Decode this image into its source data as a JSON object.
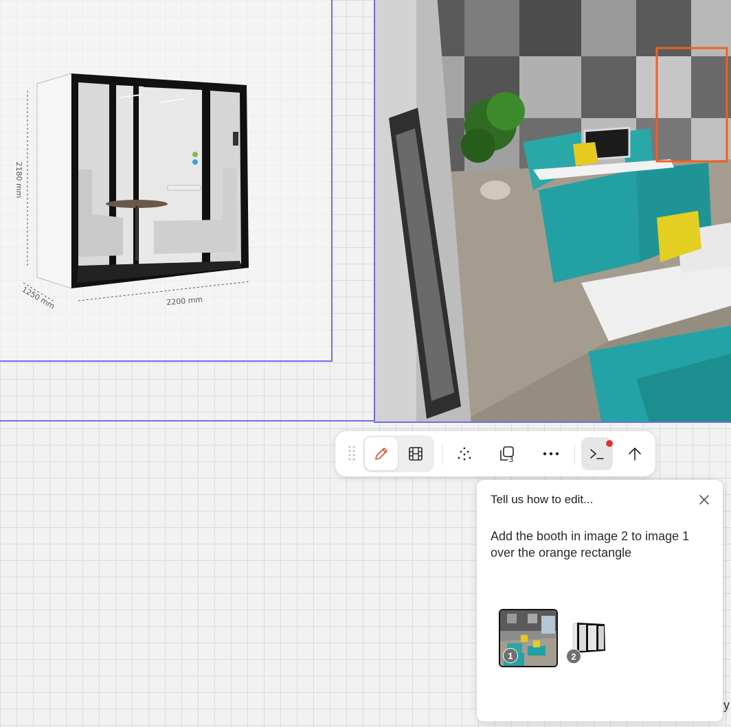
{
  "canvas": {
    "grid_color": "#dcdcdc",
    "selection_color": "#6e6ee8",
    "edge_text": "y"
  },
  "booth_image": {
    "dimension_height": "2180 mm",
    "dimension_depth": "1250 mm",
    "dimension_width": "2200 mm"
  },
  "office_image": {
    "highlight_color": "#f06022"
  },
  "toolbar": {
    "items": [
      {
        "name": "drag-handle",
        "icon": "grip-dots-icon"
      },
      {
        "name": "edit-button",
        "icon": "pencil-icon",
        "active": true,
        "color": "#ef4a2a"
      },
      {
        "name": "video-button",
        "icon": "film-strip-icon"
      },
      {
        "name": "scatter-button",
        "icon": "scatter-dots-icon"
      },
      {
        "name": "batch-button",
        "icon": "image-stack-3-icon",
        "badge": "3"
      },
      {
        "name": "more-button",
        "icon": "ellipsis-icon"
      },
      {
        "name": "prompt-button",
        "icon": "terminal-prompt-icon",
        "notification": true
      },
      {
        "name": "upload-button",
        "icon": "arrow-up-icon"
      }
    ],
    "batch_count": "3"
  },
  "prompt_panel": {
    "title": "Tell us how to edit...",
    "text": "Add the booth in image 2 to image 1 over the orange rectangle",
    "close_icon": "close-icon",
    "attachments": [
      {
        "number": "1",
        "selected": true
      },
      {
        "number": "2",
        "selected": false
      }
    ]
  }
}
